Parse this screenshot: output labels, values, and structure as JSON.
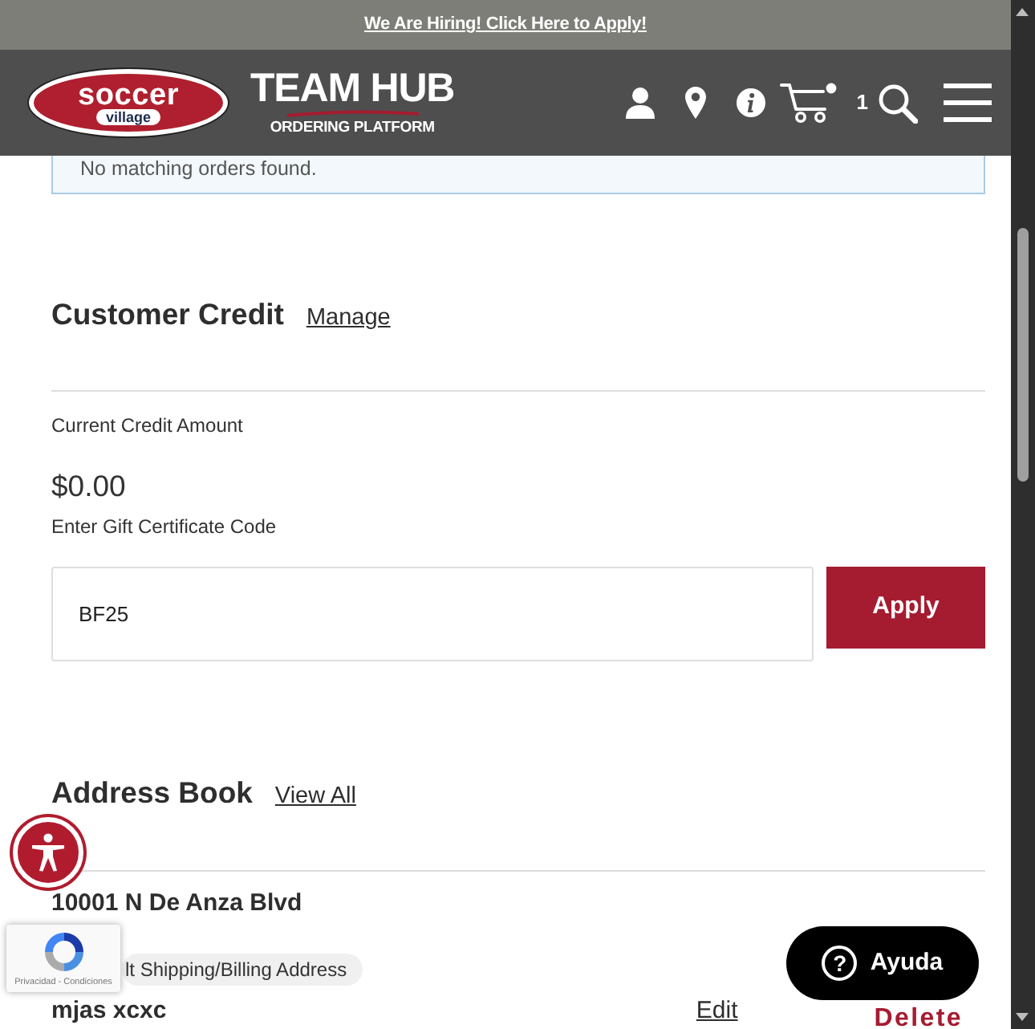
{
  "top_banner": {
    "link": "We Are Hiring! Click Here to Apply!"
  },
  "header": {
    "logo": {
      "brand": "soccer",
      "sub": "village"
    },
    "title": "TEAM HUB",
    "subtitle": "ORDERING PLATFORM",
    "cart_count": "1"
  },
  "orders": {
    "message": "No matching orders found."
  },
  "customer_credit": {
    "title": "Customer Credit",
    "link": "Manage",
    "amount_label": "Current Credit Amount",
    "amount": "$0.00",
    "code_label": "Enter Gift Certificate Code",
    "code_value": "BF25",
    "button": "Apply"
  },
  "address_book": {
    "title": "Address Book",
    "link": "View All",
    "addresses": [
      {
        "street": "10001 N De Anza Blvd",
        "tag": "lt Shipping/Billing Address",
        "name": "mjas xcxc",
        "edit": "Edit",
        "delete": "Delete"
      }
    ]
  },
  "recaptcha": {
    "text": "Privacidad - Condiciones"
  },
  "help_button": {
    "icon": "?",
    "label": "Ayuda"
  }
}
